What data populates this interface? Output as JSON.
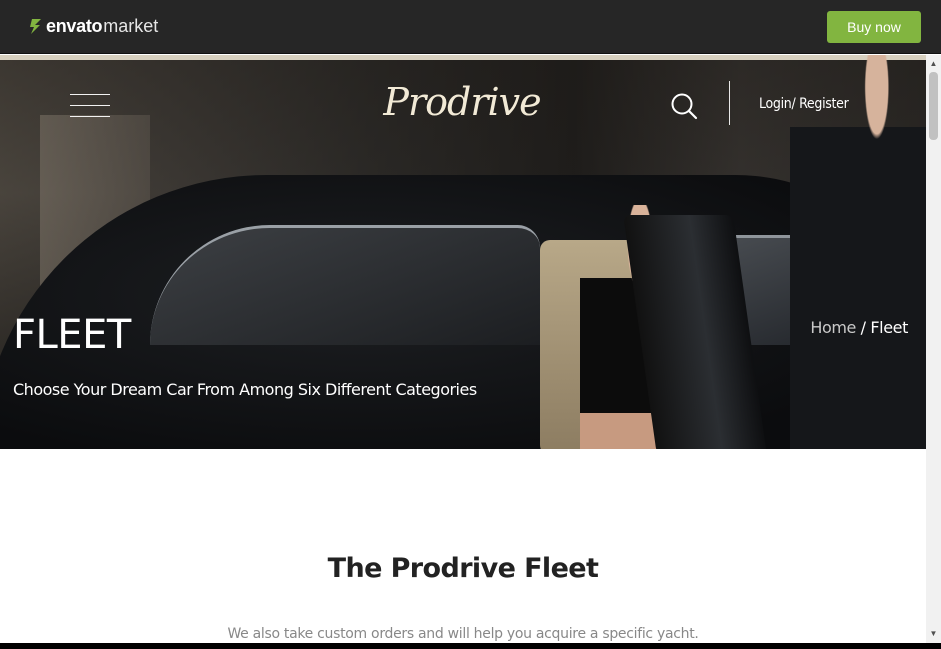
{
  "envato_bar": {
    "brand": "envato",
    "market": "market",
    "buy_button": "Buy now",
    "accent": "#82b540"
  },
  "header": {
    "logo": "Prodrive",
    "login_register": "Login/ Register",
    "menu_icon": "hamburger-menu-icon",
    "search_icon": "search-icon"
  },
  "hero": {
    "title": "FLEET",
    "subtitle": "Choose Your Dream Car From Among Six Different Categories",
    "breadcrumb": {
      "home": "Home",
      "separator": " / ",
      "current": "Fleet"
    }
  },
  "main": {
    "section_title": "The Prodrive Fleet",
    "section_text": "We also take custom orders and will help you acquire a specific yacht."
  },
  "scrollbar": {
    "up_icon": "scroll-up-arrow-icon",
    "down_icon": "scroll-down-arrow-icon"
  }
}
